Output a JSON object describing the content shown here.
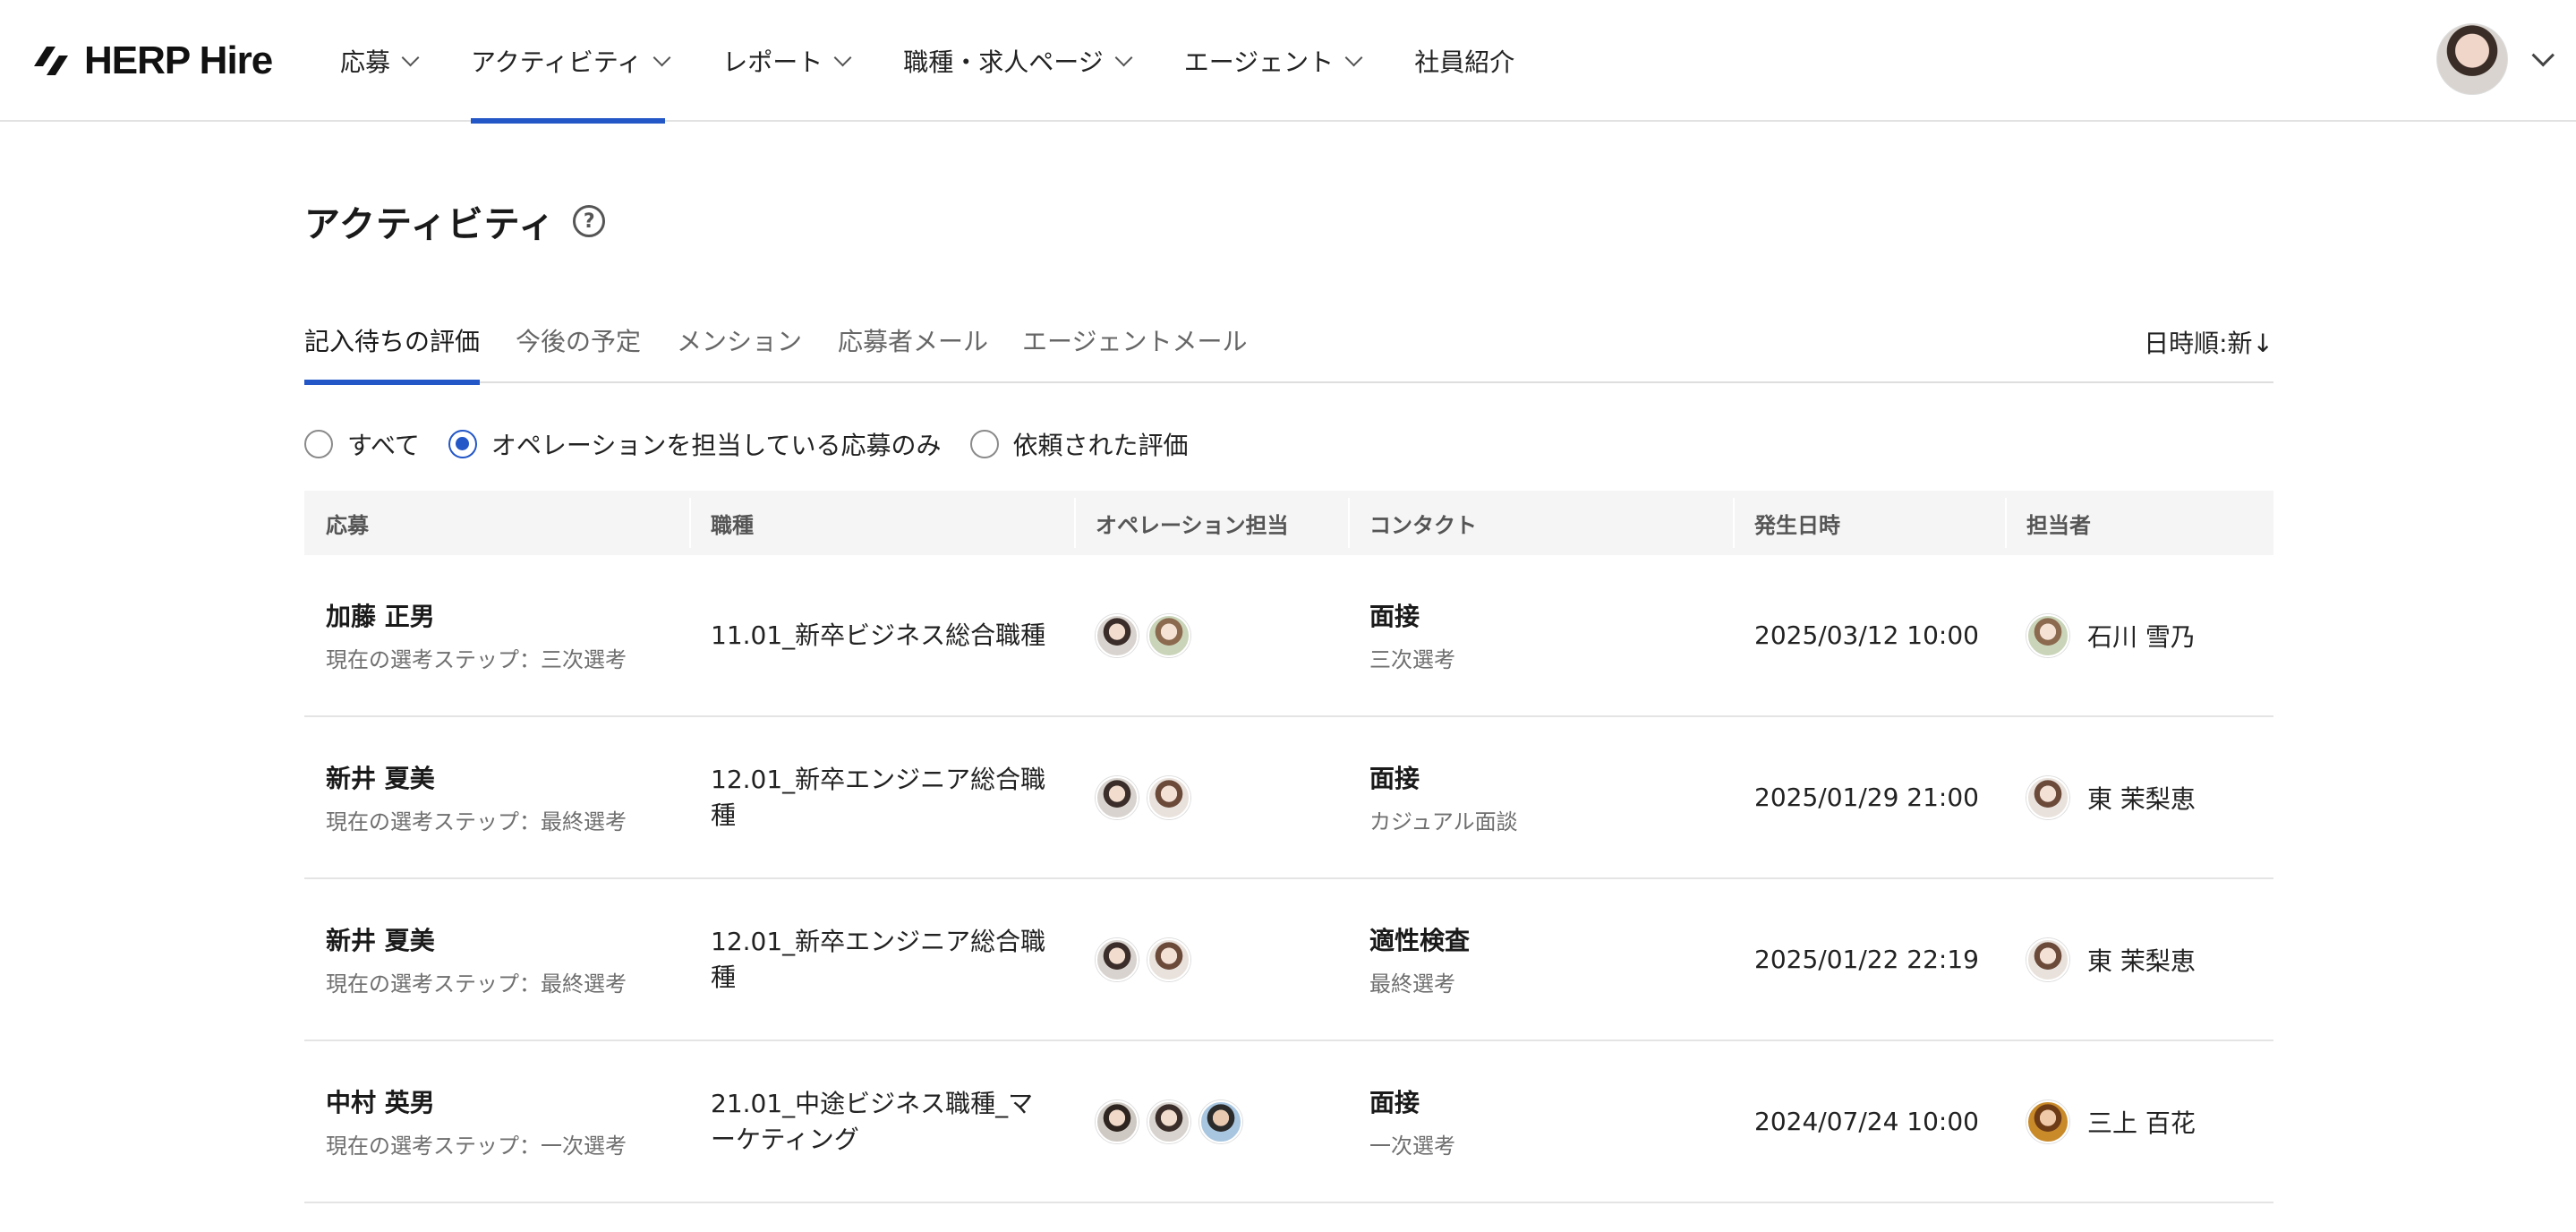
{
  "brand": {
    "name": "HERP Hire"
  },
  "nav": {
    "items": [
      {
        "label": "応募",
        "has_dropdown": true,
        "active": false
      },
      {
        "label": "アクティビティ",
        "has_dropdown": true,
        "active": true
      },
      {
        "label": "レポート",
        "has_dropdown": true,
        "active": false
      },
      {
        "label": "職種・求人ページ",
        "has_dropdown": true,
        "active": false
      },
      {
        "label": "エージェント",
        "has_dropdown": true,
        "active": false
      },
      {
        "label": "社員紹介",
        "has_dropdown": false,
        "active": false
      }
    ]
  },
  "page": {
    "title": "アクティビティ",
    "help_icon": "question-circle-icon"
  },
  "tabs": {
    "items": [
      {
        "label": "記入待ちの評価",
        "active": true
      },
      {
        "label": "今後の予定",
        "active": false
      },
      {
        "label": "メンション",
        "active": false
      },
      {
        "label": "応募者メール",
        "active": false
      },
      {
        "label": "エージェントメール",
        "active": false
      }
    ],
    "sort_label": "日時順:新↓"
  },
  "filters": {
    "options": [
      {
        "label": "すべて",
        "checked": false
      },
      {
        "label": "オペレーションを担当している応募のみ",
        "checked": true
      },
      {
        "label": "依頼された評価",
        "checked": false
      }
    ]
  },
  "table": {
    "columns": [
      "応募",
      "職種",
      "オペレーション担当",
      "コンタクト",
      "発生日時",
      "担当者"
    ],
    "rows": [
      {
        "applicant": "加藤 正男",
        "step": "現在の選考ステップ：三次選考",
        "job": "11.01_新卒ビジネス総合職種",
        "operators": [
          "a",
          "b"
        ],
        "contact_type": "面接",
        "contact_stage": "三次選考",
        "datetime": "2025/03/12 10:00",
        "assignee": "石川 雪乃",
        "assignee_avatar": "b"
      },
      {
        "applicant": "新井 夏美",
        "step": "現在の選考ステップ：最終選考",
        "job": "12.01_新卒エンジニア総合職種",
        "operators": [
          "a",
          "c"
        ],
        "contact_type": "面接",
        "contact_stage": "カジュアル面談",
        "datetime": "2025/01/29 21:00",
        "assignee": "東 茉梨恵",
        "assignee_avatar": "c"
      },
      {
        "applicant": "新井 夏美",
        "step": "現在の選考ステップ：最終選考",
        "job": "12.01_新卒エンジニア総合職種",
        "operators": [
          "a",
          "c"
        ],
        "contact_type": "適性検査",
        "contact_stage": "最終選考",
        "datetime": "2025/01/22 22:19",
        "assignee": "東 茉梨恵",
        "assignee_avatar": "c"
      },
      {
        "applicant": "中村 英男",
        "step": "現在の選考ステップ：一次選考",
        "job": "21.01_中途ビジネス職種_マーケティング",
        "operators": [
          "d",
          "a",
          "e"
        ],
        "contact_type": "面接",
        "contact_stage": "一次選考",
        "datetime": "2024/07/24 10:00",
        "assignee": "三上 百花",
        "assignee_avatar": "f"
      }
    ]
  },
  "colors": {
    "accent": "#2356c7",
    "header_border": "#e2e2e2",
    "table_header_bg": "#f5f5f5"
  }
}
